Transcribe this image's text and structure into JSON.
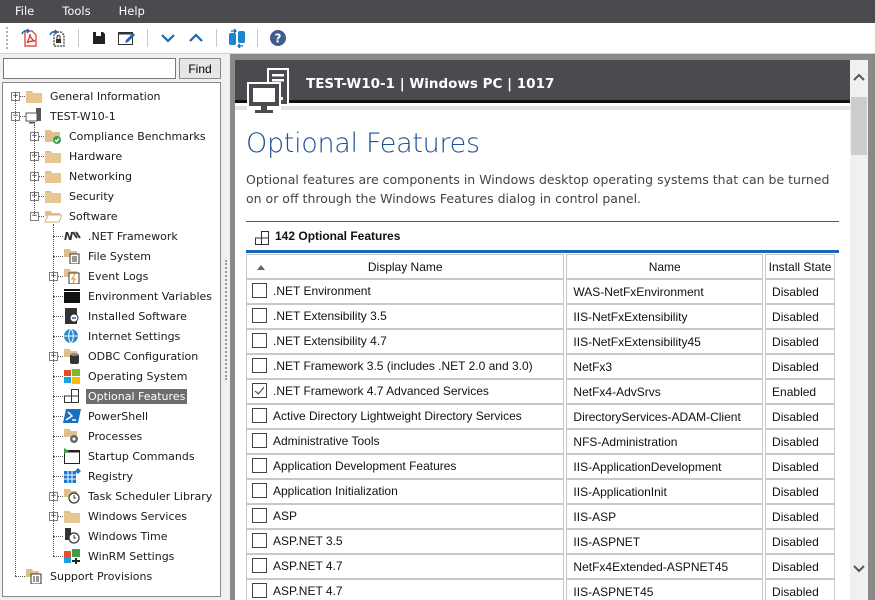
{
  "menu": {
    "items": [
      "File",
      "Tools",
      "Help"
    ]
  },
  "toolbar": {
    "buttons": [
      {
        "icon": "export-pdf-icon",
        "tooltip": ""
      },
      {
        "icon": "export-secure-icon",
        "tooltip": ""
      },
      {
        "icon": "save-icon",
        "tooltip": ""
      },
      {
        "icon": "edit-icon",
        "tooltip": ""
      },
      {
        "icon": "chevron-down-icon",
        "tooltip": ""
      },
      {
        "icon": "chevron-up-icon",
        "tooltip": ""
      },
      {
        "icon": "compare-databases-icon",
        "tooltip": ""
      },
      {
        "icon": "help-icon",
        "tooltip": ""
      }
    ]
  },
  "search": {
    "value": "",
    "placeholder": "",
    "find_label": "Find"
  },
  "tree": {
    "items": [
      {
        "label": "General Information",
        "level": 0,
        "expander": "plus",
        "icon": "folder-icon"
      },
      {
        "label": "TEST-W10-1",
        "level": 0,
        "expander": "minus",
        "icon": "computer-icon"
      },
      {
        "label": "Compliance Benchmarks",
        "level": 1,
        "expander": "plus",
        "icon": "folder-check-icon"
      },
      {
        "label": "Hardware",
        "level": 1,
        "expander": "plus",
        "icon": "folder-icon"
      },
      {
        "label": "Networking",
        "level": 1,
        "expander": "plus",
        "icon": "folder-icon"
      },
      {
        "label": "Security",
        "level": 1,
        "expander": "plus",
        "icon": "folder-icon"
      },
      {
        "label": "Software",
        "level": 1,
        "expander": "minus",
        "icon": "folder-open-icon"
      },
      {
        "label": ".NET Framework",
        "level": 2,
        "expander": "none",
        "icon": "dotnet-icon"
      },
      {
        "label": "File System",
        "level": 2,
        "expander": "none",
        "icon": "file-system-icon"
      },
      {
        "label": "Event Logs",
        "level": 2,
        "expander": "plus",
        "icon": "event-log-icon"
      },
      {
        "label": "Environment Variables",
        "level": 2,
        "expander": "none",
        "icon": "console-window-icon"
      },
      {
        "label": "Installed Software",
        "level": 2,
        "expander": "none",
        "icon": "installed-software-icon"
      },
      {
        "label": "Internet Settings",
        "level": 2,
        "expander": "none",
        "icon": "globe-icon"
      },
      {
        "label": "ODBC Configuration",
        "level": 2,
        "expander": "plus",
        "icon": "database-icon"
      },
      {
        "label": "Operating System",
        "level": 2,
        "expander": "none",
        "icon": "windows-logo-icon"
      },
      {
        "label": "Optional Features",
        "level": 2,
        "expander": "none",
        "icon": "features-grid-icon",
        "selected": true
      },
      {
        "label": "PowerShell",
        "level": 2,
        "expander": "none",
        "icon": "powershell-icon"
      },
      {
        "label": "Processes",
        "level": 2,
        "expander": "none",
        "icon": "processes-gear-icon"
      },
      {
        "label": "Startup Commands",
        "level": 2,
        "expander": "none",
        "icon": "startup-window-icon"
      },
      {
        "label": "Registry",
        "level": 2,
        "expander": "none",
        "icon": "registry-icon"
      },
      {
        "label": "Task Scheduler Library",
        "level": 2,
        "expander": "plus",
        "icon": "clock-folder-icon"
      },
      {
        "label": "Windows Services",
        "level": 2,
        "expander": "plus",
        "icon": "folder-icon"
      },
      {
        "label": "Windows Time",
        "level": 2,
        "expander": "none",
        "icon": "clock-icon"
      },
      {
        "label": "WinRM Settings",
        "level": 2,
        "expander": "none",
        "icon": "winrm-icon"
      },
      {
        "label": "Support Provisions",
        "level": 0,
        "expander": "none",
        "icon": "support-folder-icon"
      }
    ]
  },
  "header": {
    "title": "TEST-W10-1 | Windows PC | 1017"
  },
  "page": {
    "title": "Optional Features",
    "description": "Optional features are components in Windows desktop operating systems that can be turned on or off through the Windows Features dialog in control panel."
  },
  "grid": {
    "count_label": "142 Optional Features",
    "columns": [
      "Display Name",
      "Name",
      "Install State"
    ],
    "sort": {
      "column": "Display Name",
      "direction": "ascending"
    },
    "rows": [
      {
        "checked": false,
        "display_name": ".NET Environment",
        "name": "WAS-NetFxEnvironment",
        "state": "Disabled"
      },
      {
        "checked": false,
        "display_name": ".NET Extensibility 3.5",
        "name": "IIS-NetFxExtensibility",
        "state": "Disabled"
      },
      {
        "checked": false,
        "display_name": ".NET Extensibility 4.7",
        "name": "IIS-NetFxExtensibility45",
        "state": "Disabled"
      },
      {
        "checked": false,
        "display_name": ".NET Framework 3.5 (includes .NET 2.0 and 3.0)",
        "name": "NetFx3",
        "state": "Disabled"
      },
      {
        "checked": true,
        "display_name": ".NET Framework 4.7 Advanced Services",
        "name": "NetFx4-AdvSrvs",
        "state": "Enabled"
      },
      {
        "checked": false,
        "display_name": "Active Directory Lightweight Directory Services",
        "name": "DirectoryServices-ADAM-Client",
        "state": "Disabled"
      },
      {
        "checked": false,
        "display_name": "Administrative Tools",
        "name": "NFS-Administration",
        "state": "Disabled"
      },
      {
        "checked": false,
        "display_name": "Application Development Features",
        "name": "IIS-ApplicationDevelopment",
        "state": "Disabled"
      },
      {
        "checked": false,
        "display_name": "Application Initialization",
        "name": "IIS-ApplicationInit",
        "state": "Disabled"
      },
      {
        "checked": false,
        "display_name": "ASP",
        "name": "IIS-ASP",
        "state": "Disabled"
      },
      {
        "checked": false,
        "display_name": "ASP.NET 3.5",
        "name": "IIS-ASPNET",
        "state": "Disabled"
      },
      {
        "checked": false,
        "display_name": "ASP.NET 4.7",
        "name": "NetFx4Extended-ASPNET45",
        "state": "Disabled"
      },
      {
        "checked": false,
        "display_name": "ASP.NET 4.7",
        "name": "IIS-ASPNET45",
        "state": "Disabled"
      }
    ]
  },
  "colors": {
    "menubar_bg": "#4a4a4f",
    "header_bg": "#4a4a4f",
    "title_blue": "#1d4f91",
    "accent_blue": "#1b66b5",
    "selection_bg": "#6d6d6d",
    "frame_gray": "#8a8a8a"
  }
}
